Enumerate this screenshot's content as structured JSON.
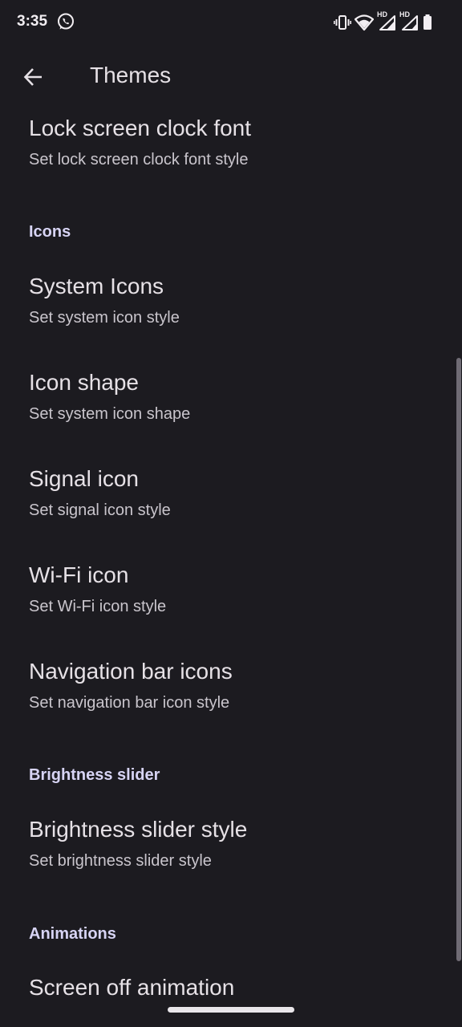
{
  "status_bar": {
    "time": "3:35",
    "notification_icons": [
      "whatsapp-icon"
    ],
    "system_icons": [
      "vibrate-icon",
      "wifi-icon",
      "signal-hd-icon",
      "signal-hd-icon",
      "battery-icon"
    ],
    "hd_label": "HD"
  },
  "app_bar": {
    "title": "Themes",
    "back_icon": "arrow-back-icon"
  },
  "preferences": {
    "lock_clock_font": {
      "title": "Lock screen clock font",
      "summary": "Set lock screen clock font style"
    },
    "icons_category": "Icons",
    "system_icons": {
      "title": "System Icons",
      "summary": "Set system icon style"
    },
    "icon_shape": {
      "title": "Icon shape",
      "summary": "Set system icon shape"
    },
    "signal_icon": {
      "title": "Signal icon",
      "summary": "Set signal icon style"
    },
    "wifi_icon": {
      "title": "Wi-Fi icon",
      "summary": "Set Wi-Fi icon style"
    },
    "nav_bar_icons": {
      "title": "Navigation bar icons",
      "summary": "Set navigation bar icon style"
    },
    "brightness_category": "Brightness slider",
    "brightness_slider_style": {
      "title": "Brightness slider style",
      "summary": "Set brightness slider style"
    },
    "animations_category": "Animations",
    "screen_off_animation": {
      "title": "Screen off animation"
    }
  },
  "colors": {
    "background": "#1c1b20",
    "primary_text": "#e6e1e6",
    "secondary_text": "#c9c5cc",
    "category_text": "#d7d4f4"
  }
}
